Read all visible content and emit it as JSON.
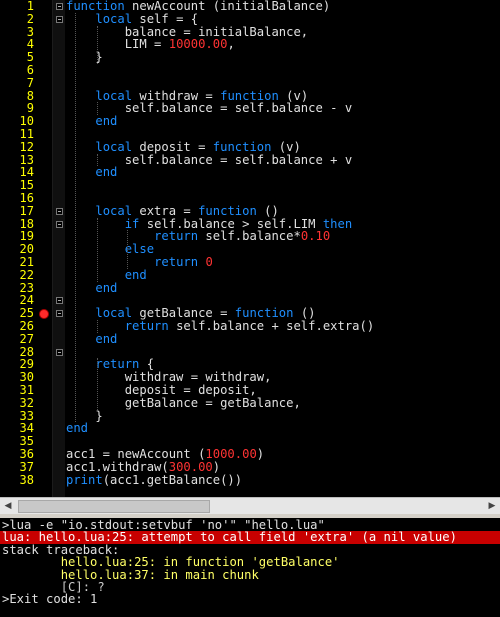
{
  "editor": {
    "line_numbers": [
      "1",
      "2",
      "3",
      "4",
      "5",
      "6",
      "7",
      "8",
      "9",
      "10",
      "11",
      "12",
      "13",
      "14",
      "15",
      "16",
      "17",
      "18",
      "19",
      "20",
      "21",
      "22",
      "23",
      "24",
      "25",
      "26",
      "27",
      "28",
      "29",
      "30",
      "31",
      "32",
      "33",
      "34",
      "35",
      "36",
      "37",
      "38"
    ],
    "lines": [
      [
        [
          "k",
          "function"
        ],
        [
          "s",
          " newAccount (initialBalance)"
        ]
      ],
      [
        [
          "s",
          "    "
        ],
        [
          "k",
          "local"
        ],
        [
          "s",
          " self = {"
        ]
      ],
      [
        [
          "s",
          "        balance = initialBalance,"
        ]
      ],
      [
        [
          "s",
          "        LIM = "
        ],
        [
          "n",
          "10000.00"
        ],
        [
          "s",
          ","
        ]
      ],
      [
        [
          "s",
          "    }"
        ]
      ],
      [],
      [],
      [
        [
          "s",
          "    "
        ],
        [
          "k",
          "local"
        ],
        [
          "s",
          " withdraw = "
        ],
        [
          "k",
          "function"
        ],
        [
          "s",
          " (v)"
        ]
      ],
      [
        [
          "s",
          "        self.balance = self.balance - v"
        ]
      ],
      [
        [
          "s",
          "    "
        ],
        [
          "k",
          "end"
        ]
      ],
      [],
      [
        [
          "s",
          "    "
        ],
        [
          "k",
          "local"
        ],
        [
          "s",
          " deposit = "
        ],
        [
          "k",
          "function"
        ],
        [
          "s",
          " (v)"
        ]
      ],
      [
        [
          "s",
          "        self.balance = self.balance + v"
        ]
      ],
      [
        [
          "s",
          "    "
        ],
        [
          "k",
          "end"
        ]
      ],
      [],
      [],
      [
        [
          "s",
          "    "
        ],
        [
          "k",
          "local"
        ],
        [
          "s",
          " extra = "
        ],
        [
          "k",
          "function"
        ],
        [
          "s",
          " ()"
        ]
      ],
      [
        [
          "s",
          "        "
        ],
        [
          "k",
          "if"
        ],
        [
          "s",
          " self.balance > self.LIM "
        ],
        [
          "k",
          "then"
        ]
      ],
      [
        [
          "s",
          "            "
        ],
        [
          "k",
          "return"
        ],
        [
          "s",
          " self.balance*"
        ],
        [
          "n",
          "0.10"
        ]
      ],
      [
        [
          "s",
          "        "
        ],
        [
          "k",
          "else"
        ]
      ],
      [
        [
          "s",
          "            "
        ],
        [
          "k",
          "return"
        ],
        [
          "s",
          " "
        ],
        [
          "n",
          "0"
        ]
      ],
      [
        [
          "s",
          "        "
        ],
        [
          "k",
          "end"
        ]
      ],
      [
        [
          "s",
          "    "
        ],
        [
          "k",
          "end"
        ]
      ],
      [],
      [
        [
          "s",
          "    "
        ],
        [
          "k",
          "local"
        ],
        [
          "s",
          " getBalance = "
        ],
        [
          "k",
          "function"
        ],
        [
          "s",
          " ()"
        ]
      ],
      [
        [
          "s",
          "        "
        ],
        [
          "k",
          "return"
        ],
        [
          "s",
          " self.balance + self.extra()"
        ]
      ],
      [
        [
          "s",
          "    "
        ],
        [
          "k",
          "end"
        ]
      ],
      [],
      [
        [
          "s",
          "    "
        ],
        [
          "k",
          "return"
        ],
        [
          "s",
          " {"
        ]
      ],
      [
        [
          "s",
          "        withdraw = withdraw,"
        ]
      ],
      [
        [
          "s",
          "        deposit = deposit,"
        ]
      ],
      [
        [
          "s",
          "        getBalance = getBalance,"
        ]
      ],
      [
        [
          "s",
          "    }"
        ]
      ],
      [
        [
          "k",
          "end"
        ]
      ],
      [],
      [
        [
          "s",
          "acc1 = newAccount ("
        ],
        [
          "n",
          "1000.00"
        ],
        [
          "s",
          ")"
        ]
      ],
      [
        [
          "s",
          "acc1.withdraw("
        ],
        [
          "n",
          "300.00"
        ],
        [
          "s",
          ")"
        ]
      ],
      [
        [
          "k",
          "print"
        ],
        [
          "s",
          "(acc1.getBalance())"
        ]
      ],
      []
    ],
    "fold_markers": [
      1,
      2,
      17,
      18,
      24,
      25,
      28
    ],
    "breakpoint_line": 25
  },
  "output": {
    "lines": [
      {
        "text": ">lua -e \"io.stdout:setvbuf 'no'\" \"hello.lua\"",
        "style": "normal"
      },
      {
        "text": "lua: hello.lua:25: attempt to call field 'extra' (a nil value)",
        "style": "err"
      },
      {
        "text": "stack traceback:",
        "style": "normal"
      },
      {
        "text": "        hello.lua:25: in function 'getBalance'",
        "style": "yellow"
      },
      {
        "text": "        hello.lua:37: in main chunk",
        "style": "yellow"
      },
      {
        "text": "        [C]: ?",
        "style": "dim"
      },
      {
        "text": ">Exit code: 1",
        "style": "normal"
      }
    ]
  },
  "colors": {
    "keyword": "#1f8fff",
    "number": "#ff3333",
    "line_number": "#ffff00",
    "error_background": "#c80000",
    "breakpoint": "#ff2a2a"
  },
  "icons": {
    "fold_marker": "fold-marker-icon",
    "breakpoint": "breakpoint-icon",
    "scroll_left": "scroll-left-arrow-icon",
    "scroll_right": "scroll-right-arrow-icon"
  }
}
